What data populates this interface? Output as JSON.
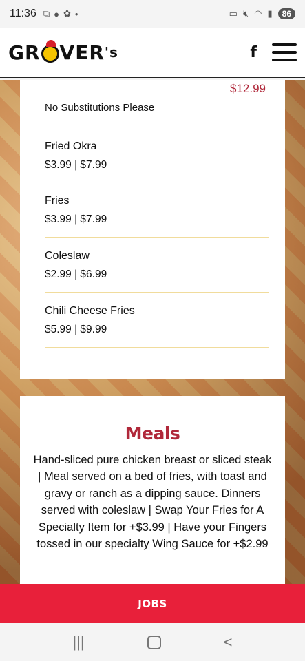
{
  "status": {
    "time": "11:36",
    "battery": "86",
    "left_icons": [
      "screen-record-icon",
      "messenger-icon",
      "app-icon",
      "dot-icon"
    ],
    "right_icons": [
      "cast-icon",
      "mute-icon",
      "wifi-icon",
      "signal-icon"
    ]
  },
  "header": {
    "logo_text_pre": "GR",
    "logo_text_post": "VER",
    "logo_suffix": "'s",
    "facebook_icon": "f"
  },
  "menu_card": {
    "top_price": "$12.99",
    "note": "No Substitutions Please",
    "items": [
      {
        "name": "Fried Okra",
        "price": "$3.99 | $7.99"
      },
      {
        "name": "Fries",
        "price": "$3.99 | $7.99"
      },
      {
        "name": "Coleslaw",
        "price": "$2.99 | $6.99"
      },
      {
        "name": "Chili Cheese Fries",
        "price": "$5.99 | $9.99"
      }
    ]
  },
  "meals": {
    "title": "Meals",
    "description": "Hand-sliced pure chicken breast or sliced steak | Meal served on a bed of fries, with toast and gravy or ranch as a dipping sauce. Dinners served with coleslaw | Swap Your Fries for A Specialty Item for +$3.99 | Have your Fingers tossed in our specialty Wing Sauce for +$2.99"
  },
  "jobs": {
    "label": "JOBS"
  },
  "nav": {
    "recent": "|||",
    "back": "<"
  },
  "colors": {
    "accent": "#b0283a",
    "jobs_bar": "#e8203a",
    "separator": "#f1dc9c"
  }
}
